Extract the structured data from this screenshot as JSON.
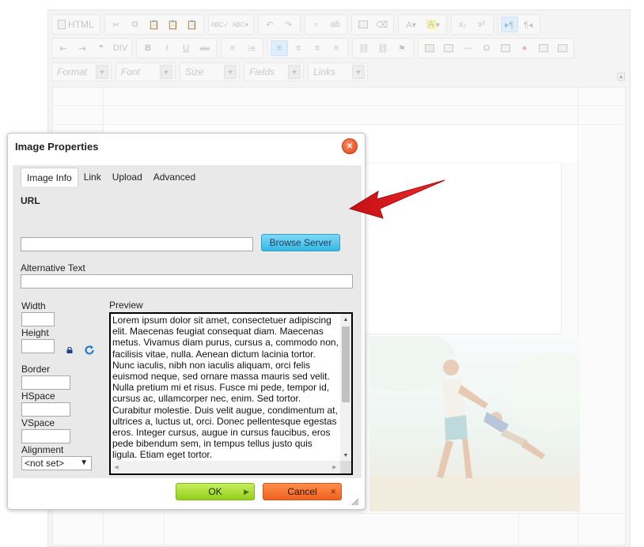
{
  "editor": {
    "toolbar": {
      "source_label": "HTML",
      "combos": [
        "Format",
        "Font",
        "Size",
        "Fields",
        "Links"
      ]
    }
  },
  "dialog": {
    "title": "Image Properties",
    "tabs": [
      "Image Info",
      "Link",
      "Upload",
      "Advanced"
    ],
    "active_tab": "Image Info",
    "url": {
      "label": "URL",
      "value": ""
    },
    "browse_button": "Browse Server",
    "alt_text": {
      "label": "Alternative Text",
      "value": ""
    },
    "width": {
      "label": "Width",
      "value": ""
    },
    "height": {
      "label": "Height",
      "value": ""
    },
    "border": {
      "label": "Border",
      "value": ""
    },
    "hspace": {
      "label": "HSpace",
      "value": ""
    },
    "vspace": {
      "label": "VSpace",
      "value": ""
    },
    "alignment": {
      "label": "Alignment",
      "selected": "<not set>"
    },
    "preview": {
      "label": "Preview",
      "text": "Lorem ipsum dolor sit amet, consectetuer adipiscing elit. Maecenas feugiat consequat diam. Maecenas metus. Vivamus diam purus, cursus a, commodo non, facilisis vitae, nulla. Aenean dictum lacinia tortor. Nunc iaculis, nibh non iaculis aliquam, orci felis euismod neque, sed ornare massa mauris sed velit. Nulla pretium mi et risus. Fusce mi pede, tempor id, cursus ac, ullamcorper nec, enim. Sed tortor. Curabitur molestie. Duis velit augue, condimentum at, ultrices a, luctus ut, orci. Donec pellentesque egestas eros. Integer cursus, augue in cursus faucibus, eros pede bibendum sem, in tempus tellus justo quis ligula. Etiam eget tortor."
    },
    "ok_button": "OK",
    "cancel_button": "Cancel"
  },
  "colors": {
    "browse": "#35b7e5",
    "ok": "#93cf1c",
    "cancel": "#f0601f",
    "close": "#e0421a",
    "annotation_arrow": "#e3161c"
  }
}
